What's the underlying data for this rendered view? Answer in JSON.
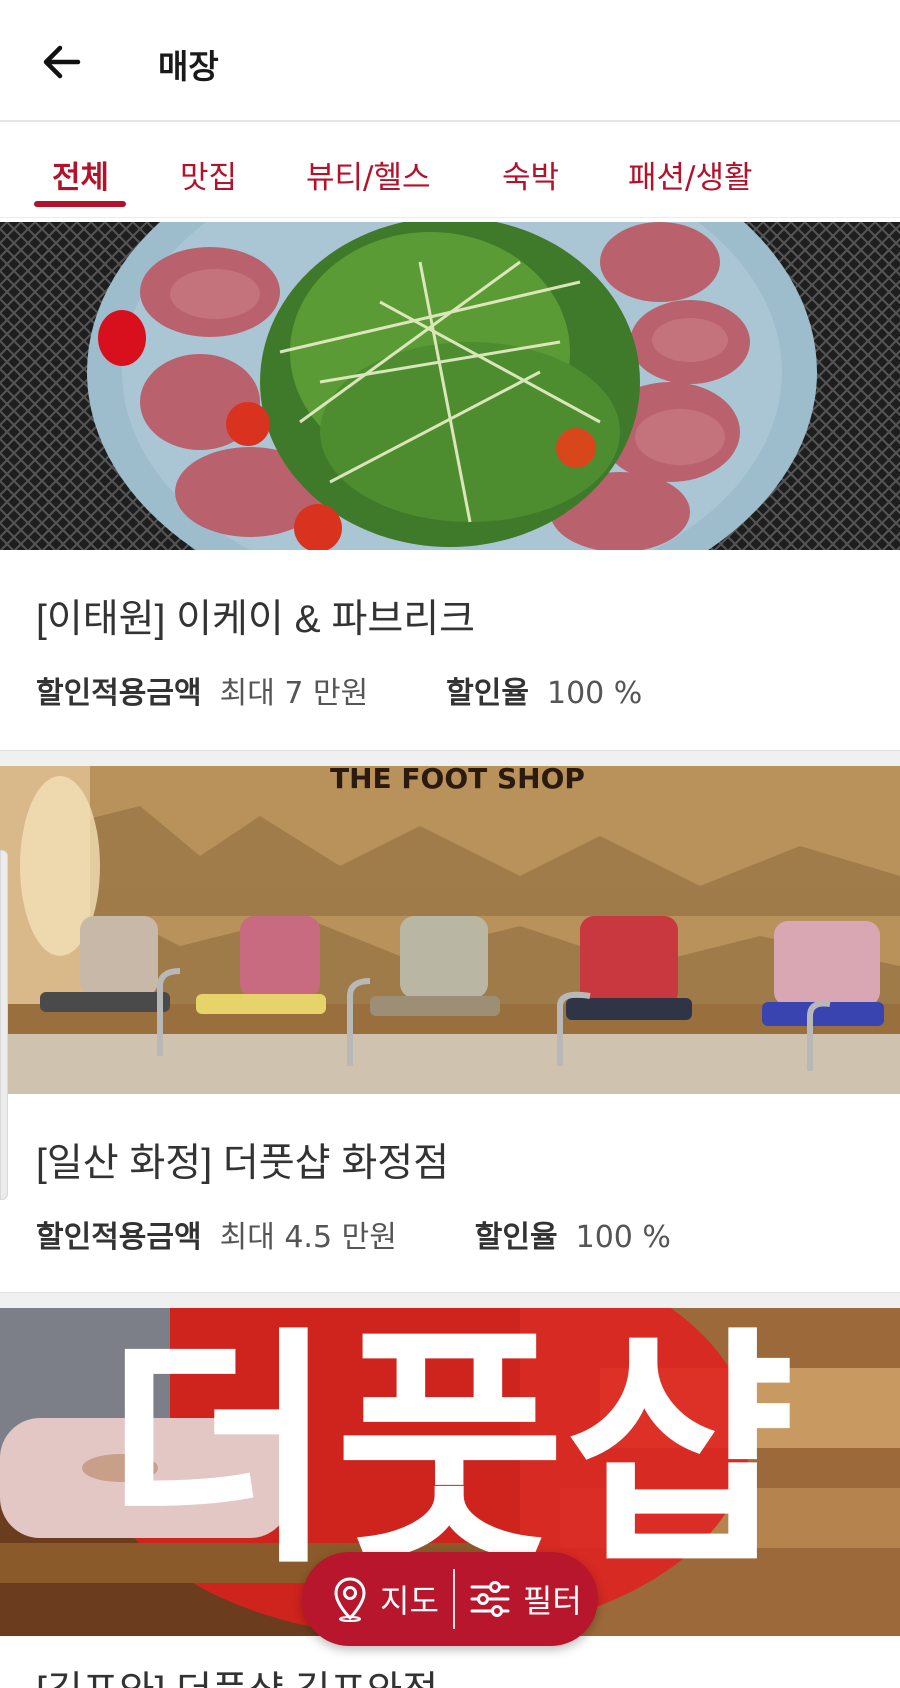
{
  "header": {
    "title": "매장",
    "back_icon": "arrow-left-icon"
  },
  "tabs": [
    {
      "label": "전체",
      "active": true
    },
    {
      "label": "맛집",
      "active": false
    },
    {
      "label": "뷰티/헬스",
      "active": false
    },
    {
      "label": "숙박",
      "active": false
    },
    {
      "label": "패션/생활",
      "active": false
    }
  ],
  "stores": [
    {
      "name": "[이태원] 이케이 & 파브리크",
      "discount_amount_label": "할인적용금액",
      "discount_amount_value": "최대 7 만원",
      "discount_rate_label": "할인율",
      "discount_rate_value": "100 %",
      "image": "salad-with-seared-beef"
    },
    {
      "name": "[일산 화정] 더풋샵 화정점",
      "discount_amount_label": "할인적용금액",
      "discount_amount_value": "최대 4.5 만원",
      "discount_rate_label": "할인율",
      "discount_rate_value": "100 %",
      "image": "foot-shop-interior",
      "image_sign_text": "THE FOOT SHOP"
    },
    {
      "name": "[김포와] 더풋샵 김포와점",
      "image": "foot-shop-red-logo",
      "image_logo_text": "더풋샵"
    }
  ],
  "floating": {
    "map_label": "지도",
    "filter_label": "필터",
    "map_icon": "map-pin-icon",
    "filter_icon": "sliders-icon"
  },
  "colors": {
    "accent": "#b3122a",
    "float_bg": "#b7162d",
    "divider": "#f0f0f0"
  }
}
